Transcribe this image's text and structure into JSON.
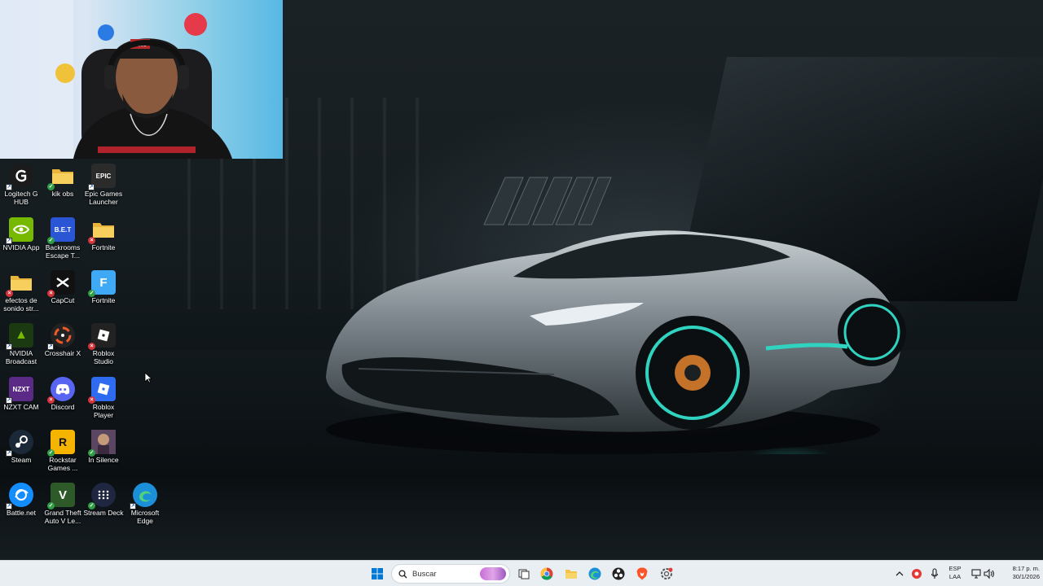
{
  "desktop": {
    "icons": [
      {
        "label": "Logitech G HUB",
        "icon": "logitech-ghub-icon",
        "color": "#1b1b1b"
      },
      {
        "label": "kik obs",
        "icon": "folder-icon",
        "color": "#f3c347"
      },
      {
        "label": "Epic Games Launcher",
        "icon": "epic-games-icon",
        "color": "#2b2b2b"
      },
      {
        "label": "NVIDIA App",
        "icon": "nvidia-icon",
        "color": "#76b900"
      },
      {
        "label": "Backrooms Escape T...",
        "icon": "backrooms-game-icon",
        "color": "#2a56d6"
      },
      {
        "label": "Fortnite",
        "icon": "folder-icon",
        "color": "#f3c347"
      },
      {
        "label": "efectos de sonido str...",
        "icon": "folder-icon",
        "color": "#f3c347"
      },
      {
        "label": "CapCut",
        "icon": "capcut-icon",
        "color": "#111111"
      },
      {
        "label": "Fortnite",
        "icon": "fortnite-icon",
        "color": "#3fa9f5"
      },
      {
        "label": "NVIDIA Broadcast",
        "icon": "nvidia-broadcast-icon",
        "color": "#1b3a12"
      },
      {
        "label": "Crosshair X",
        "icon": "crosshair-icon",
        "color": "#222222"
      },
      {
        "label": "Roblox Studio",
        "icon": "roblox-studio-icon",
        "color": "#222222"
      },
      {
        "label": "NZXT CAM",
        "icon": "nzxt-cam-icon",
        "color": "#5b2a86"
      },
      {
        "label": "Discord",
        "icon": "discord-icon",
        "color": "#5865f2"
      },
      {
        "label": "Roblox Player",
        "icon": "roblox-player-icon",
        "color": "#2f6bf0"
      },
      {
        "label": "Steam",
        "icon": "steam-icon",
        "color": "#1b2838"
      },
      {
        "label": "Rockstar Games ...",
        "icon": "rockstar-icon",
        "color": "#f4b400"
      },
      {
        "label": "In Silence",
        "icon": "in-silence-game-icon",
        "color": "#6a4a6e"
      },
      {
        "label": "Battle.net",
        "icon": "battlenet-icon",
        "color": "#148eff"
      },
      {
        "label": "Grand Theft Auto V Le...",
        "icon": "gta-v-icon",
        "color": "#2e5a2a"
      },
      {
        "label": "Stream Deck",
        "icon": "stream-deck-icon",
        "color": "#1e2640"
      },
      {
        "label": "Microsoft Edge",
        "icon": "edge-icon",
        "color": "#1c8fd9"
      }
    ],
    "glyphs": {
      "epic": "EPIC",
      "nvidia_broadcast": "▲",
      "nzxt": "NZXT",
      "rockstar": "R",
      "gta": "V",
      "fortnite": "F",
      "backrooms": "B.E.T"
    }
  },
  "webcam": {
    "cap_text": "1239"
  },
  "taskbar": {
    "search_placeholder": "Buscar",
    "language_line1": "ESP",
    "language_line2": "LAA",
    "time": "8:17 p. m.",
    "date": "30/1/2026",
    "pinned": [
      "start-icon",
      "task-view-icon",
      "chrome-icon",
      "file-explorer-icon",
      "edge-icon",
      "obs-icon",
      "brave-icon",
      "settings-icon"
    ]
  },
  "colors": {
    "taskbar_bg": "#e9eef3",
    "windows_blue": "#0078d4",
    "car_teal": "#2fd3c0"
  }
}
